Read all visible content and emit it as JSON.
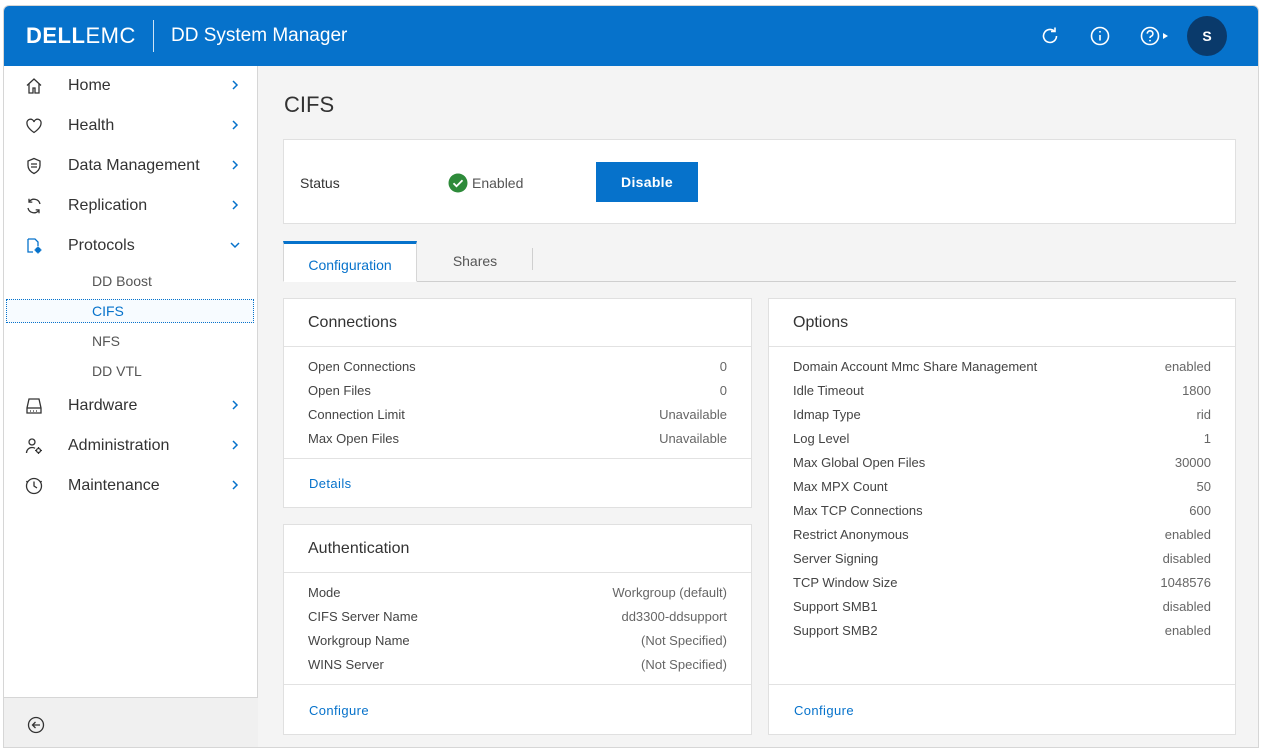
{
  "header": {
    "logo_dell": "DELL",
    "logo_emc": "EMC",
    "app_title": "DD System Manager",
    "user_initial": "S"
  },
  "sidebar": {
    "items": [
      {
        "label": "Home",
        "icon": "home-icon"
      },
      {
        "label": "Health",
        "icon": "heart-icon"
      },
      {
        "label": "Data Management",
        "icon": "shield-icon"
      },
      {
        "label": "Replication",
        "icon": "sync-icon"
      },
      {
        "label": "Protocols",
        "icon": "protocols-icon",
        "expanded": true
      },
      {
        "label": "Hardware",
        "icon": "hard-drive-icon"
      },
      {
        "label": "Administration",
        "icon": "user-gear-icon"
      },
      {
        "label": "Maintenance",
        "icon": "clock-icon"
      }
    ],
    "protocol_subitems": [
      {
        "label": "DD Boost"
      },
      {
        "label": "CIFS",
        "active": true
      },
      {
        "label": "NFS"
      },
      {
        "label": "DD VTL"
      }
    ]
  },
  "page": {
    "title": "CIFS",
    "status_label": "Status",
    "status_value": "Enabled",
    "disable_button": "Disable"
  },
  "tabs": [
    {
      "label": "Configuration",
      "active": true
    },
    {
      "label": "Shares",
      "active": false
    }
  ],
  "connections": {
    "title": "Connections",
    "rows": [
      {
        "key": "Open Connections",
        "value": "0"
      },
      {
        "key": "Open Files",
        "value": "0"
      },
      {
        "key": "Connection Limit",
        "value": "Unavailable"
      },
      {
        "key": "Max Open Files",
        "value": "Unavailable"
      }
    ],
    "link": "Details"
  },
  "authentication": {
    "title": "Authentication",
    "rows": [
      {
        "key": "Mode",
        "value": "Workgroup (default)"
      },
      {
        "key": "CIFS Server Name",
        "value": "dd3300-ddsupport"
      },
      {
        "key": "Workgroup Name",
        "value": "(Not Specified)"
      },
      {
        "key": "WINS Server",
        "value": "(Not Specified)"
      }
    ],
    "link": "Configure"
  },
  "options": {
    "title": "Options",
    "rows": [
      {
        "key": "Domain Account Mmc Share Management",
        "value": "enabled"
      },
      {
        "key": "Idle Timeout",
        "value": "1800"
      },
      {
        "key": "Idmap Type",
        "value": "rid"
      },
      {
        "key": "Log Level",
        "value": "1"
      },
      {
        "key": "Max Global Open Files",
        "value": "30000"
      },
      {
        "key": "Max MPX Count",
        "value": "50"
      },
      {
        "key": "Max TCP Connections",
        "value": "600"
      },
      {
        "key": "Restrict Anonymous",
        "value": "enabled"
      },
      {
        "key": "Server Signing",
        "value": "disabled"
      },
      {
        "key": "TCP Window Size",
        "value": "1048576"
      },
      {
        "key": "Support SMB1",
        "value": "disabled"
      },
      {
        "key": "Support SMB2",
        "value": "enabled"
      }
    ],
    "link": "Configure"
  },
  "colors": {
    "brand_blue": "#0672cb",
    "avatar_bg": "#0a3a6b",
    "status_green": "#2e8b3a"
  }
}
